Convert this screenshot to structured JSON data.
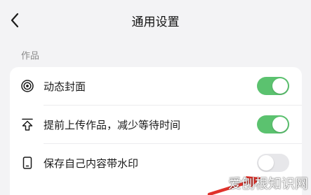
{
  "header": {
    "title": "通用设置",
    "back_icon": "chevron-left-icon"
  },
  "section": {
    "label": "作品"
  },
  "settings": [
    {
      "icon": "target-icon",
      "label": "动态封面",
      "enabled": true
    },
    {
      "icon": "upload-icon",
      "label": "提前上传作品，减少等待时间",
      "enabled": true
    },
    {
      "icon": "phone-icon",
      "label": "保存自己内容带水印",
      "enabled": false
    }
  ],
  "watermark": {
    "text": "爱刨根知识网"
  },
  "colors": {
    "toggle_on": "#5bc26f",
    "toggle_off": "#e7e7ea",
    "background": "#f3f3f5",
    "arrow": "#e0322b"
  }
}
